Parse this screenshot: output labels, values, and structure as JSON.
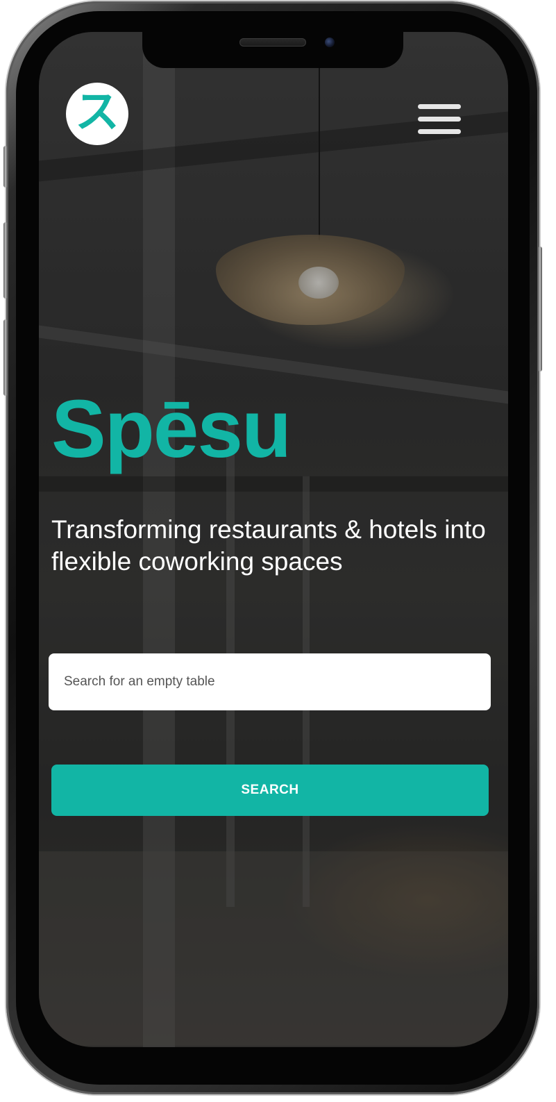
{
  "header": {
    "logo_glyph": "ス",
    "menu_icon": "hamburger-menu-icon"
  },
  "hero": {
    "brand": "Spēsu",
    "tagline": "Transforming restaurants & hotels into flexible coworking spaces"
  },
  "search": {
    "placeholder": "Search for an empty table",
    "value": "",
    "button_label": "SEARCH"
  },
  "colors": {
    "accent": "#12b5a5",
    "text_light": "#ffffff",
    "input_bg": "#ffffff"
  }
}
